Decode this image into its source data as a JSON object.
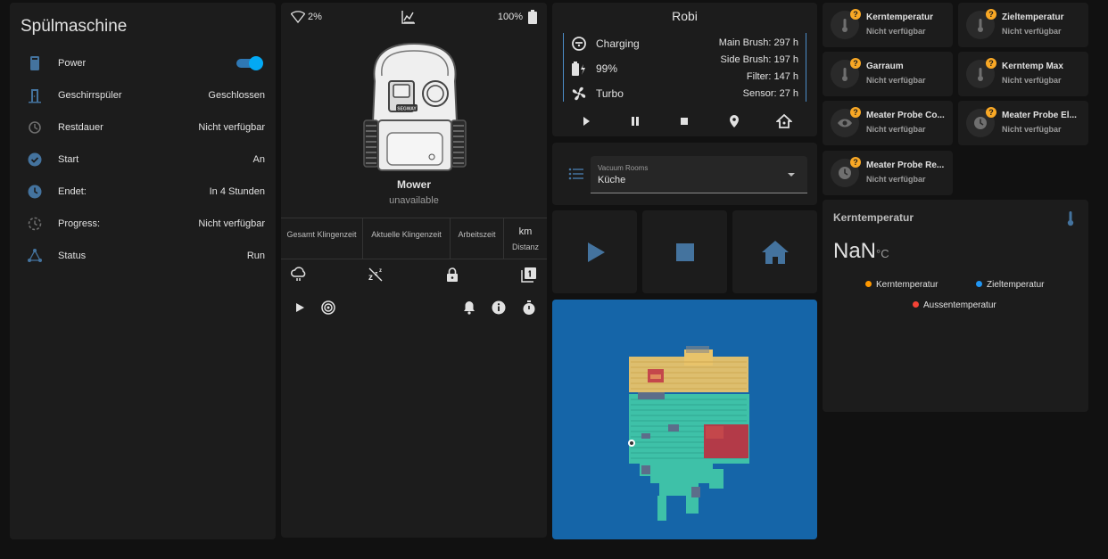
{
  "dishwasher": {
    "title": "Spülmaschine",
    "rows": [
      {
        "label": "Power",
        "value": ""
      },
      {
        "label": "Geschirrspüler",
        "value": "Geschlossen"
      },
      {
        "label": "Restdauer",
        "value": "Nicht verfügbar"
      },
      {
        "label": "Start",
        "value": "An"
      },
      {
        "label": "Endet:",
        "value": "In 4 Stunden"
      },
      {
        "label": "Progress:",
        "value": "Nicht verfügbar"
      },
      {
        "label": "Status",
        "value": "Run"
      }
    ],
    "power_on": true
  },
  "mower": {
    "wifi": "2%",
    "battery": "100%",
    "name": "Mower",
    "state": "unavailable",
    "stats": [
      {
        "label": "Gesamt Klingenzeit",
        "value": ""
      },
      {
        "label": "Aktuelle Klingenzeit",
        "value": ""
      },
      {
        "label": "Arbeitszeit",
        "value": ""
      },
      {
        "label": "Distanz",
        "value": "km"
      }
    ],
    "logo_text": "SEGWAY"
  },
  "robi": {
    "title": "Robi",
    "status": "Charging",
    "battery": "99%",
    "fan": "Turbo",
    "main_brush": "Main Brush: 297 h",
    "side_brush": "Side Brush: 197 h",
    "filter": "Filter: 147 h",
    "sensor": "Sensor: 27 h"
  },
  "rooms": {
    "label": "Vacuum Rooms",
    "value": "Küche"
  },
  "sensors": [
    {
      "name": "Kerntemperatur",
      "state": "Nicht verfügbar",
      "icon": "thermometer-icon"
    },
    {
      "name": "Zieltemperatur",
      "state": "Nicht verfügbar",
      "icon": "thermometer-icon"
    },
    {
      "name": "Garraum",
      "state": "Nicht verfügbar",
      "icon": "thermometer-icon"
    },
    {
      "name": "Kerntemp Max",
      "state": "Nicht verfügbar",
      "icon": "thermometer-icon"
    },
    {
      "name": "Meater Probe Co...",
      "state": "Nicht verfügbar",
      "icon": "eye-icon"
    },
    {
      "name": "Meater Probe El...",
      "state": "Nicht verfügbar",
      "icon": "clock-icon"
    },
    {
      "name": "Meater Probe Re...",
      "state": "Nicht verfügbar",
      "icon": "clock-icon"
    }
  ],
  "kern": {
    "title": "Kerntemperatur",
    "value": "NaN",
    "unit": "°C",
    "legend": [
      {
        "name": "Kerntemperatur",
        "color": "#ff9800"
      },
      {
        "name": "Zieltemperatur",
        "color": "#2196f3"
      },
      {
        "name": "Aussentemperatur",
        "color": "#f44336"
      }
    ]
  },
  "colors": {
    "accent": "#03a9f4",
    "icon_blue": "#44739e",
    "map_bg": "#1565a8",
    "warning": "#f9a825"
  }
}
